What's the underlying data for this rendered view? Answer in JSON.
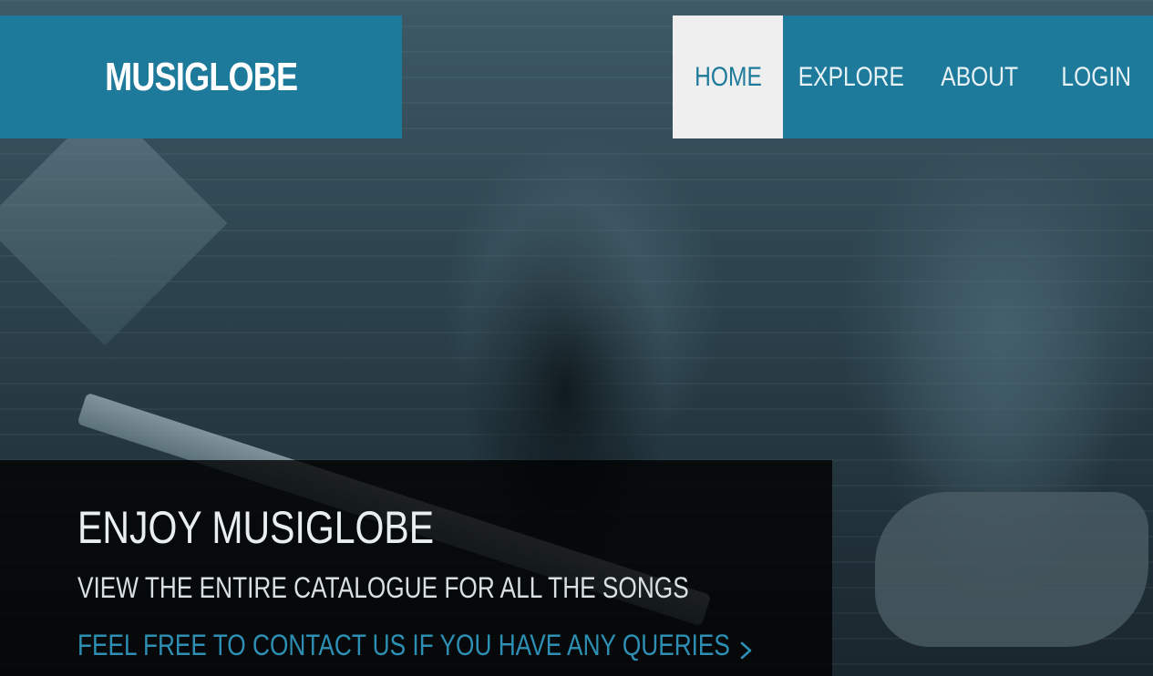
{
  "brand": {
    "name": "MUSIGLOBE"
  },
  "nav": {
    "items": [
      {
        "label": "HOME",
        "active": true
      },
      {
        "label": "EXPLORE",
        "active": false
      },
      {
        "label": "ABOUT",
        "active": false
      },
      {
        "label": "LOGIN",
        "active": false
      }
    ]
  },
  "hero": {
    "title": "ENJOY MUSIGLOBE",
    "subtitle": "VIEW THE ENTIRE CATALOGUE FOR ALL THE SONGS",
    "link_text": "FEEL FREE TO CONTACT US IF YOU HAVE ANY QUERIES",
    "link_icon": "chevron-right-icon"
  },
  "colors": {
    "brand_blue": "#1d7a9a",
    "link_blue": "#2d8fb3",
    "active_nav_bg": "#efefef"
  }
}
